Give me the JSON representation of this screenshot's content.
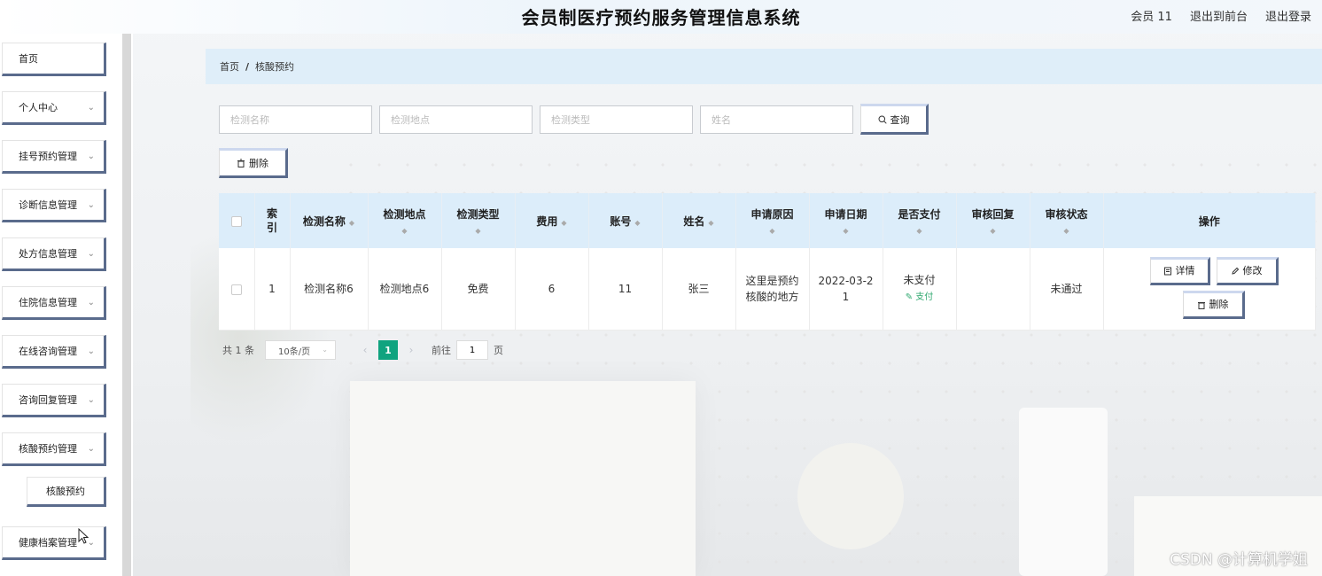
{
  "header": {
    "title": "会员制医疗预约服务管理信息系统",
    "user": "会员 11",
    "to_front": "退出到前台",
    "logout": "退出登录"
  },
  "sidebar": {
    "items": [
      {
        "label": "首页",
        "has_arrow": false
      },
      {
        "label": "个人中心",
        "has_arrow": true
      },
      {
        "label": "挂号预约管理",
        "has_arrow": true
      },
      {
        "label": "诊断信息管理",
        "has_arrow": true
      },
      {
        "label": "处方信息管理",
        "has_arrow": true
      },
      {
        "label": "住院信息管理",
        "has_arrow": true
      },
      {
        "label": "在线咨询管理",
        "has_arrow": true
      },
      {
        "label": "咨询回复管理",
        "has_arrow": true
      },
      {
        "label": "核酸预约管理",
        "has_arrow": true
      },
      {
        "label": "健康档案管理",
        "has_arrow": true
      }
    ],
    "sub_item": "核酸预约"
  },
  "breadcrumb": {
    "home": "首页",
    "separator": "/",
    "current": "核酸预约"
  },
  "search": {
    "name_placeholder": "检测名称",
    "location_placeholder": "检测地点",
    "type_placeholder": "检测类型",
    "person_placeholder": "姓名",
    "query_label": "查询"
  },
  "toolbar": {
    "delete_label": "删除"
  },
  "table": {
    "headers": {
      "index": "索引",
      "test_name": "检测名称",
      "test_location": "检测地点",
      "test_type": "检测类型",
      "fee": "费用",
      "account": "账号",
      "name": "姓名",
      "reason": "申请原因",
      "date": "申请日期",
      "paid": "是否支付",
      "reply": "审核回复",
      "status": "审核状态",
      "actions": "操作"
    },
    "rows": [
      {
        "index": "1",
        "test_name": "检测名称6",
        "test_location": "检测地点6",
        "test_type": "免费",
        "fee": "6",
        "account": "11",
        "name": "张三",
        "reason": "这里是预约核酸的地方",
        "date": "2022-03-21",
        "paid": "未支付",
        "pay_link": "支付",
        "reply": "",
        "status": "未通过",
        "detail_label": "详情",
        "edit_label": "修改",
        "delete_label": "删除"
      }
    ]
  },
  "pagination": {
    "total": "共 1 条",
    "page_size": "10条/页",
    "current_page": "1",
    "goto_prefix": "前往",
    "goto_value": "1",
    "goto_suffix": "页"
  },
  "watermark": "CSDN @计算机学姐",
  "colors": {
    "accent_border": "#5a6b8c",
    "header_bg": "#dcedfa",
    "page_active": "#10a37f",
    "pay_link": "#2fa86f"
  }
}
